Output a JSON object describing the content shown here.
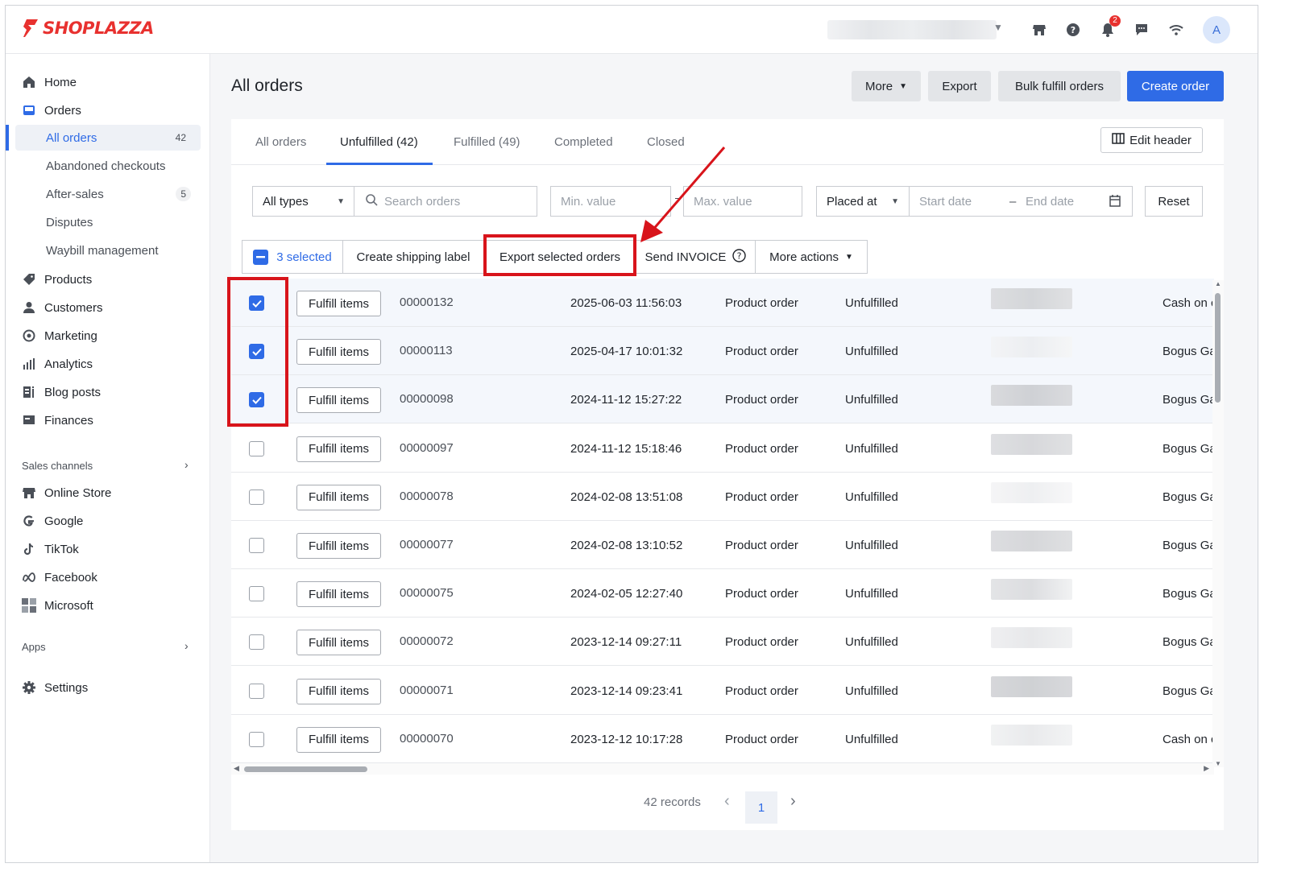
{
  "app": {
    "logo_text": "SHOPLAZZA",
    "avatar_initial": "A",
    "notification_count": "2",
    "brand_color": "#e8312f",
    "accent_color": "#2f6be6"
  },
  "sidebar": {
    "home": "Home",
    "orders": "Orders",
    "sub": [
      {
        "label": "All orders",
        "count": "42"
      },
      {
        "label": "Abandoned checkouts",
        "count": ""
      },
      {
        "label": "After-sales",
        "count": "5"
      },
      {
        "label": "Disputes",
        "count": ""
      },
      {
        "label": "Waybill management",
        "count": ""
      }
    ],
    "products": "Products",
    "customers": "Customers",
    "marketing": "Marketing",
    "analytics": "Analytics",
    "blog_posts": "Blog posts",
    "finances": "Finances",
    "sales_channels": "Sales channels",
    "online_store": "Online Store",
    "google": "Google",
    "tiktok": "TikTok",
    "facebook": "Facebook",
    "microsoft": "Microsoft",
    "apps": "Apps",
    "settings": "Settings"
  },
  "header": {
    "title": "All orders",
    "more": "More",
    "export": "Export",
    "bulk_fulfill": "Bulk fulfill orders",
    "create_order": "Create order"
  },
  "tabs": [
    "All orders",
    "Unfulfilled (42)",
    "Fulfilled (49)",
    "Completed",
    "Closed"
  ],
  "edit_header": "Edit header",
  "filters": {
    "type": "All types",
    "search_placeholder": "Search orders",
    "min_placeholder": "Min. value",
    "max_placeholder": "Max. value",
    "date_field": "Placed at",
    "start_placeholder": "Start date",
    "end_placeholder": "End date",
    "reset": "Reset"
  },
  "bulk": {
    "selected": "3 selected",
    "create_label": "Create shipping label",
    "export_selected": "Export selected orders",
    "send_invoice": "Send INVOICE",
    "more_actions": "More actions"
  },
  "orders": [
    {
      "checked": true,
      "action": "Fulfill items",
      "id": "00000132",
      "date": "2025-06-03 11:56:03",
      "type": "Product order",
      "status": "Unfulfilled",
      "payment": "Cash on c"
    },
    {
      "checked": true,
      "action": "Fulfill items",
      "id": "00000113",
      "date": "2025-04-17 10:01:32",
      "type": "Product order",
      "status": "Unfulfilled",
      "payment": "Bogus Ga"
    },
    {
      "checked": true,
      "action": "Fulfill items",
      "id": "00000098",
      "date": "2024-11-12 15:27:22",
      "type": "Product order",
      "status": "Unfulfilled",
      "payment": "Bogus Ga"
    },
    {
      "checked": false,
      "action": "Fulfill items",
      "id": "00000097",
      "date": "2024-11-12 15:18:46",
      "type": "Product order",
      "status": "Unfulfilled",
      "payment": "Bogus Ga"
    },
    {
      "checked": false,
      "action": "Fulfill items",
      "id": "00000078",
      "date": "2024-02-08 13:51:08",
      "type": "Product order",
      "status": "Unfulfilled",
      "payment": "Bogus Ga"
    },
    {
      "checked": false,
      "action": "Fulfill items",
      "id": "00000077",
      "date": "2024-02-08 13:10:52",
      "type": "Product order",
      "status": "Unfulfilled",
      "payment": "Bogus Ga"
    },
    {
      "checked": false,
      "action": "Fulfill items",
      "id": "00000075",
      "date": "2024-02-05 12:27:40",
      "type": "Product order",
      "status": "Unfulfilled",
      "payment": "Bogus Ga"
    },
    {
      "checked": false,
      "action": "Fulfill items",
      "id": "00000072",
      "date": "2023-12-14 09:27:11",
      "type": "Product order",
      "status": "Unfulfilled",
      "payment": "Bogus Ga"
    },
    {
      "checked": false,
      "action": "Fulfill items",
      "id": "00000071",
      "date": "2023-12-14 09:23:41",
      "type": "Product order",
      "status": "Unfulfilled",
      "payment": "Bogus Ga"
    },
    {
      "checked": false,
      "action": "Fulfill items",
      "id": "00000070",
      "date": "2023-12-12 10:17:28",
      "type": "Product order",
      "status": "Unfulfilled",
      "payment": "Cash on c"
    }
  ],
  "pagination": {
    "records": "42 records",
    "current_page": "1"
  }
}
